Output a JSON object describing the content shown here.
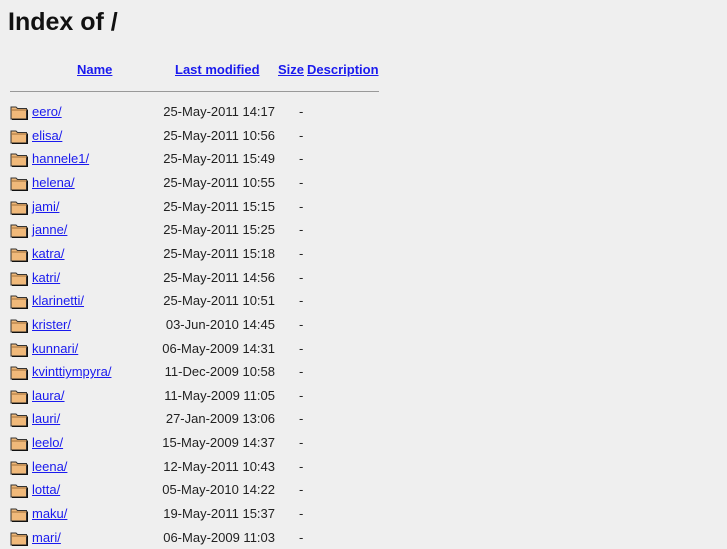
{
  "title": "Index of /",
  "headers": {
    "name": "Name",
    "modified": "Last modified",
    "size": "Size",
    "description": "Description"
  },
  "rows": [
    {
      "name": "eero/",
      "modified": "25-May-2011 14:17",
      "size": "-"
    },
    {
      "name": "elisa/",
      "modified": "25-May-2011 10:56",
      "size": "-"
    },
    {
      "name": "hannele1/",
      "modified": "25-May-2011 15:49",
      "size": "-"
    },
    {
      "name": "helena/",
      "modified": "25-May-2011 10:55",
      "size": "-"
    },
    {
      "name": "jami/",
      "modified": "25-May-2011 15:15",
      "size": "-"
    },
    {
      "name": "janne/",
      "modified": "25-May-2011 15:25",
      "size": "-"
    },
    {
      "name": "katra/",
      "modified": "25-May-2011 15:18",
      "size": "-"
    },
    {
      "name": "katri/",
      "modified": "25-May-2011 14:56",
      "size": "-"
    },
    {
      "name": "klarinetti/",
      "modified": "25-May-2011 10:51",
      "size": "-"
    },
    {
      "name": "krister/",
      "modified": "03-Jun-2010 14:45",
      "size": "-"
    },
    {
      "name": "kunnari/",
      "modified": "06-May-2009 14:31",
      "size": "-"
    },
    {
      "name": "kvinttiympyra/",
      "modified": "11-Dec-2009 10:58",
      "size": "-"
    },
    {
      "name": "laura/",
      "modified": "11-May-2009 11:05",
      "size": "-"
    },
    {
      "name": "lauri/",
      "modified": "27-Jan-2009 13:06",
      "size": "-"
    },
    {
      "name": "leelo/",
      "modified": "15-May-2009 14:37",
      "size": "-"
    },
    {
      "name": "leena/",
      "modified": "12-May-2011 10:43",
      "size": "-"
    },
    {
      "name": "lotta/",
      "modified": "05-May-2010 14:22",
      "size": "-"
    },
    {
      "name": "maku/",
      "modified": "19-May-2011 15:37",
      "size": "-"
    },
    {
      "name": "mari/",
      "modified": "06-May-2009 11:03",
      "size": "-"
    }
  ],
  "icon": "folder-icon",
  "colors": {
    "link": "#1a1aee",
    "folder": "#f0b97a"
  }
}
